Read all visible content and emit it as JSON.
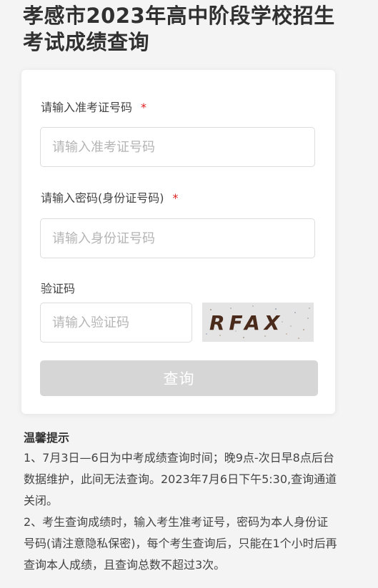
{
  "page": {
    "title": "孝感市2023年高中阶段学校招生考试成绩查询"
  },
  "form": {
    "exam_number": {
      "label": "请输入准考证号码",
      "required_mark": "*",
      "placeholder": "请输入准考证号码",
      "value": ""
    },
    "password": {
      "label": "请输入密码(身份证号码)",
      "required_mark": "*",
      "placeholder": "请输入身份证号码",
      "value": ""
    },
    "captcha": {
      "label": "验证码",
      "placeholder": "请输入验证码",
      "value": "",
      "image_text": "RFAX"
    },
    "submit_label": "查询"
  },
  "tips": {
    "title": "温馨提示",
    "items": [
      "1、7月3日—6日为中考成绩查询时间；晚9点-次日早8点后台数据维护，此间无法查询。2023年7月6日下午5:30,查询通道关闭。",
      "2、考生查询成绩时，输入考生准考证号，密码为本人身份证号码(请注意隐私保密)，每个考生查询后，只能在1个小时后再查询本人成绩，且查询总数不超过3次。"
    ]
  },
  "colors": {
    "background": "#f4f4f4",
    "card": "#ffffff",
    "required": "#e02020",
    "button_disabled": "#d6d6d6",
    "captcha_text": "#4a2a1a"
  }
}
